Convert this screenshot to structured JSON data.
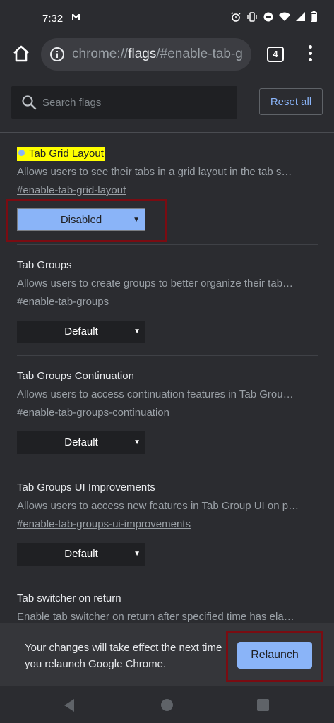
{
  "status_bar": {
    "time": "7:32",
    "notification_icon": "gmail-icon",
    "icons": [
      "alarm-icon",
      "vibrate-icon",
      "do-not-disturb-icon",
      "wifi-icon",
      "signal-icon",
      "battery-icon"
    ]
  },
  "toolbar": {
    "url_scheme": "chrome://",
    "url_host": "flags",
    "url_path": "/#enable-tab-g",
    "tab_count": "4"
  },
  "search": {
    "placeholder": "Search flags",
    "value": ""
  },
  "reset_label": "Reset all",
  "flags": [
    {
      "title": "Tab Grid Layout",
      "description": "Allows users to see their tabs in a grid layout in the tab s…",
      "link": "#enable-tab-grid-layout",
      "value": "Disabled",
      "modified": true
    },
    {
      "title": "Tab Groups",
      "description": "Allows users to create groups to better organize their tab…",
      "link": "#enable-tab-groups",
      "value": "Default"
    },
    {
      "title": "Tab Groups Continuation",
      "description": "Allows users to access continuation features in Tab Grou…",
      "link": "#enable-tab-groups-continuation",
      "value": "Default"
    },
    {
      "title": "Tab Groups UI Improvements",
      "description": "Allows users to access new features in Tab Group UI on p…",
      "link": "#enable-tab-groups-ui-improvements",
      "value": "Default"
    },
    {
      "title": "Tab switcher on return",
      "description": "Enable tab switcher on return after specified time has ela…"
    }
  ],
  "relaunch": {
    "message": "Your changes will take effect the next time you relaunch Google Chrome.",
    "button_label": "Relaunch"
  },
  "colors": {
    "background": "#2b2c30",
    "accent": "#8ab4f8",
    "highlight": "#ffff00",
    "annotation_frame": "#7a0c12"
  }
}
